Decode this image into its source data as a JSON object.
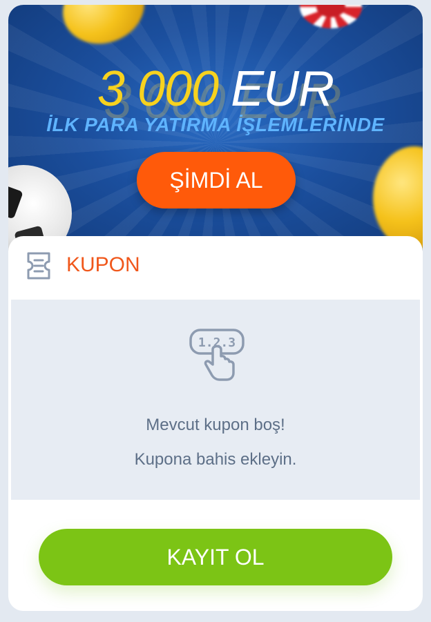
{
  "banner": {
    "amount": "3 000",
    "currency": "EUR",
    "subtitle": "İLK PARA YATIRMA İŞLEMLERİNDE",
    "cta_label": "ŞİMDİ AL"
  },
  "coupon": {
    "title": "KUPON",
    "empty_title": "Mevcut kupon boş!",
    "empty_subtitle": "Kupona bahis ekleyin.",
    "keypad_digits": "1.2.3"
  },
  "actions": {
    "register_label": "KAYIT OL"
  },
  "colors": {
    "accent_orange": "#ff5a0a",
    "title_orange": "#f0571b",
    "register_green": "#7cc415",
    "amount_yellow": "#f7d21f",
    "subtitle_blue": "#5fb4ff",
    "muted_text": "#5d6f87"
  },
  "icons": {
    "coupon": "ticket-icon",
    "empty_state": "keypad-finger-icon"
  }
}
